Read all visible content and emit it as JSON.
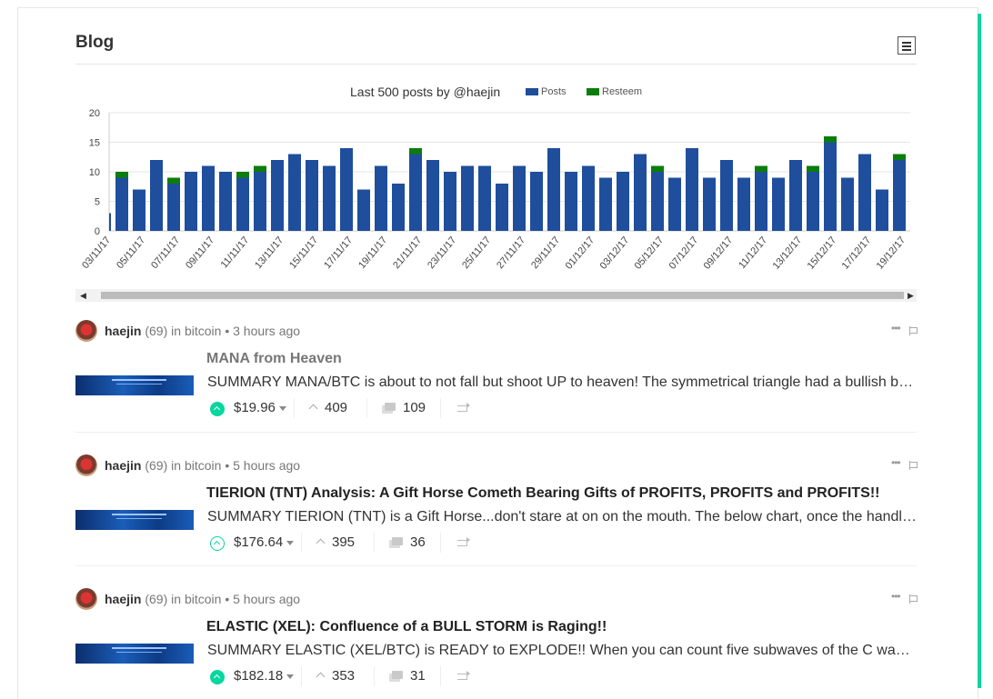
{
  "blog": {
    "title": "Blog"
  },
  "colors": {
    "accent": "#06d6a0",
    "posts": "#1f4e9c",
    "resteem": "#0b7d0b"
  },
  "chart_data": {
    "type": "bar",
    "stacked": true,
    "title": "Last 500 posts by @haejin",
    "xlabel": "",
    "ylabel": "",
    "ylim": [
      0,
      20
    ],
    "yticks": [
      0,
      5,
      10,
      15,
      20
    ],
    "grid": true,
    "legend_position": "top",
    "tick_labels": [
      "03/11/17",
      "05/11/17",
      "07/11/17",
      "09/11/17",
      "11/11/17",
      "13/11/17",
      "15/11/17",
      "17/11/17",
      "19/11/17",
      "21/11/17",
      "23/11/17",
      "25/11/17",
      "27/11/17",
      "29/11/17",
      "01/12/17",
      "03/12/17",
      "05/12/17",
      "07/12/17",
      "09/12/17",
      "11/12/17",
      "13/12/17",
      "15/12/17",
      "17/12/17",
      "19/12/17"
    ],
    "categories": [
      "03/11/17",
      "04/11/17",
      "05/11/17",
      "06/11/17",
      "07/11/17",
      "08/11/17",
      "09/11/17",
      "10/11/17",
      "11/11/17",
      "12/11/17",
      "13/11/17",
      "14/11/17",
      "15/11/17",
      "16/11/17",
      "17/11/17",
      "18/11/17",
      "19/11/17",
      "20/11/17",
      "21/11/17",
      "22/11/17",
      "23/11/17",
      "24/11/17",
      "25/11/17",
      "26/11/17",
      "27/11/17",
      "28/11/17",
      "29/11/17",
      "30/11/17",
      "01/12/17",
      "02/12/17",
      "03/12/17",
      "04/12/17",
      "05/12/17",
      "06/12/17",
      "07/12/17",
      "08/12/17",
      "09/12/17",
      "10/12/17",
      "11/12/17",
      "12/12/17",
      "13/12/17",
      "14/12/17",
      "15/12/17",
      "16/12/17",
      "17/12/17",
      "18/12/17",
      "19/12/17",
      "20/12/17"
    ],
    "series": [
      {
        "name": "Posts",
        "color": "#1f4e9c",
        "values": [
          3,
          9,
          7,
          12,
          8,
          10,
          11,
          10,
          9,
          10,
          12,
          13,
          12,
          11,
          14,
          7,
          11,
          8,
          13,
          12,
          10,
          11,
          11,
          8,
          11,
          10,
          14,
          10,
          11,
          9,
          10,
          13,
          10,
          9,
          14,
          9,
          12,
          9,
          10,
          9,
          12,
          10,
          15,
          9,
          13,
          7,
          12
        ]
      },
      {
        "name": "Resteem",
        "color": "#0b7d0b",
        "values": [
          0,
          1,
          0,
          0,
          1,
          0,
          0,
          0,
          1,
          1,
          0,
          0,
          0,
          0,
          0,
          0,
          0,
          0,
          1,
          0,
          0,
          0,
          0,
          0,
          0,
          0,
          0,
          0,
          0,
          0,
          0,
          0,
          1,
          0,
          0,
          0,
          0,
          0,
          1,
          0,
          0,
          1,
          1,
          0,
          0,
          0,
          1
        ]
      }
    ]
  },
  "posts": [
    {
      "author": "haejin",
      "reputation": "(69)",
      "in_label": "in",
      "category": "bitcoin",
      "bullet": "•",
      "time": "3 hours ago",
      "menu": "•••",
      "title": "MANA from Heaven",
      "summary": "SUMMARY MANA/BTC is about to not fall but shoot UP to heaven! The symmetrical triangle had a bullish breakout and MANA is now ready to fly high!",
      "payout": "$19.96",
      "votes": "409",
      "comments": "109"
    },
    {
      "author": "haejin",
      "reputation": "(69)",
      "in_label": "in",
      "category": "bitcoin",
      "bullet": "•",
      "time": "5 hours ago",
      "menu": "•••",
      "title": "TIERION (TNT) Analysis: A Gift Horse Cometh Bearing Gifts of PROFITS, PROFITS and PROFITS!!",
      "summary": "SUMMARY TIERION (TNT) is a Gift Horse...don't stare at on on the mouth. The below chart, once the handle completes, will be a rocket!",
      "payout": "$176.64",
      "votes": "395",
      "comments": "36"
    },
    {
      "author": "haejin",
      "reputation": "(69)",
      "in_label": "in",
      "category": "bitcoin",
      "bullet": "•",
      "time": "5 hours ago",
      "menu": "•••",
      "title": "ELASTIC (XEL): Confluence of a BULL STORM is Raging!!",
      "summary": "SUMMARY ELASTIC (XEL/BTC) is READY to EXPLODE!! When you can count five subwaves of the C wave, the bottom is in and the rally begins!",
      "payout": "$182.18",
      "votes": "353",
      "comments": "31"
    }
  ]
}
